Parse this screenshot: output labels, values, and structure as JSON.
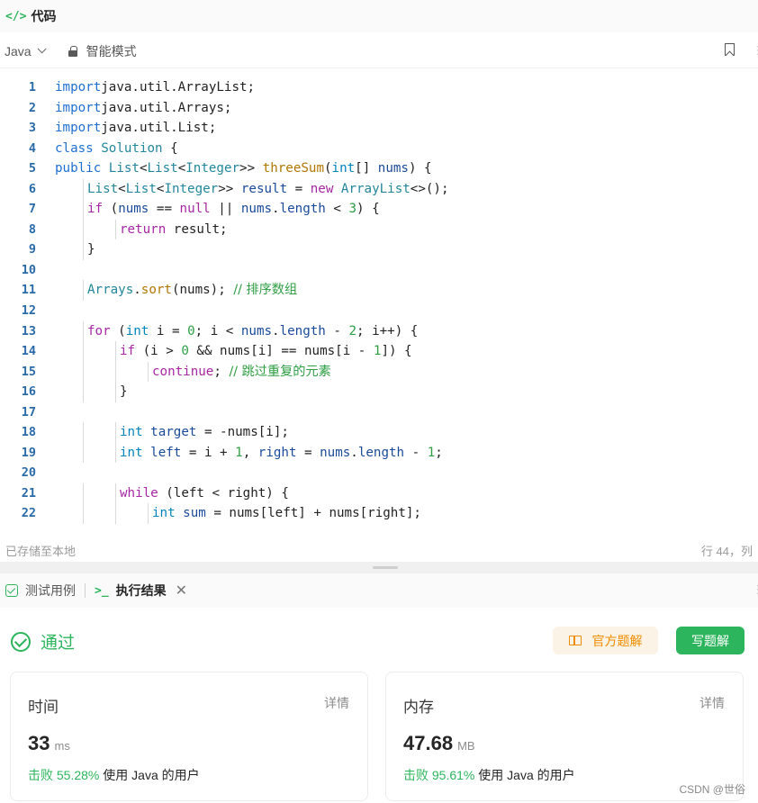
{
  "code_panel": {
    "title_icon": "</>",
    "title": "代码",
    "more": "⋮",
    "language": "Java",
    "mode": "智能模式",
    "status_left": "已存储至本地",
    "status_right": "行 44，列"
  },
  "code_lines": [
    {
      "n": "1",
      "indent": 0,
      "tokens": [
        [
          "kb",
          "import"
        ],
        [
          "",
          "java.util.ArrayList;"
        ]
      ]
    },
    {
      "n": "2",
      "indent": 0,
      "tokens": [
        [
          "kb",
          "import"
        ],
        [
          "",
          "java.util.Arrays;"
        ]
      ]
    },
    {
      "n": "3",
      "indent": 0,
      "tokens": [
        [
          "kb",
          "import"
        ],
        [
          "",
          "java.util.List;"
        ]
      ]
    },
    {
      "n": "4",
      "indent": 0,
      "tokens": [
        [
          "kb",
          "class"
        ],
        [
          "",
          " "
        ],
        [
          "tc",
          "Solution"
        ],
        [
          "",
          " {"
        ]
      ]
    },
    {
      "n": "5",
      "indent": 0,
      "tokens": [
        [
          "kb",
          "public"
        ],
        [
          "",
          " "
        ],
        [
          "tc",
          "List"
        ],
        [
          "",
          "<"
        ],
        [
          "tc",
          "List"
        ],
        [
          "",
          "<"
        ],
        [
          "tc",
          "Integer"
        ],
        [
          "",
          ">> "
        ],
        [
          "fn",
          "threeSum"
        ],
        [
          "",
          "("
        ],
        [
          "ty",
          "int"
        ],
        [
          "",
          "[] "
        ],
        [
          "vr",
          "nums"
        ],
        [
          "",
          ") {"
        ]
      ]
    },
    {
      "n": "6",
      "indent": 1,
      "tokens": [
        [
          "tc",
          "List"
        ],
        [
          "",
          "<"
        ],
        [
          "tc",
          "List"
        ],
        [
          "",
          "<"
        ],
        [
          "tc",
          "Integer"
        ],
        [
          "",
          ">> "
        ],
        [
          "vr",
          "result"
        ],
        [
          "",
          " = "
        ],
        [
          "kw",
          "new"
        ],
        [
          "",
          " "
        ],
        [
          "tc",
          "ArrayList"
        ],
        [
          "",
          "<>();"
        ]
      ]
    },
    {
      "n": "7",
      "indent": 1,
      "tokens": [
        [
          "kw",
          "if"
        ],
        [
          "",
          " ("
        ],
        [
          "vr",
          "nums"
        ],
        [
          "",
          " == "
        ],
        [
          "kw",
          "null"
        ],
        [
          "",
          " || "
        ],
        [
          "vr",
          "nums"
        ],
        [
          "",
          "."
        ],
        [
          "vr",
          "length"
        ],
        [
          "",
          " < "
        ],
        [
          "nm",
          "3"
        ],
        [
          "",
          ") {"
        ]
      ]
    },
    {
      "n": "8",
      "indent": 2,
      "tokens": [
        [
          "kw",
          "return"
        ],
        [
          "",
          " result;"
        ]
      ]
    },
    {
      "n": "9",
      "indent": 1,
      "tokens": [
        [
          "",
          "}"
        ]
      ]
    },
    {
      "n": "10",
      "indent": 0,
      "tokens": []
    },
    {
      "n": "11",
      "indent": 1,
      "tokens": [
        [
          "tc",
          "Arrays"
        ],
        [
          "",
          "."
        ],
        [
          "fn",
          "sort"
        ],
        [
          "",
          "(nums); "
        ],
        [
          "cm",
          "// 排序数组"
        ]
      ]
    },
    {
      "n": "12",
      "indent": 0,
      "tokens": []
    },
    {
      "n": "13",
      "indent": 1,
      "tokens": [
        [
          "kw",
          "for"
        ],
        [
          "",
          " ("
        ],
        [
          "ty",
          "int"
        ],
        [
          "",
          " i = "
        ],
        [
          "nm",
          "0"
        ],
        [
          "",
          "; i < "
        ],
        [
          "vr",
          "nums"
        ],
        [
          "",
          "."
        ],
        [
          "vr",
          "length"
        ],
        [
          "",
          " - "
        ],
        [
          "nm",
          "2"
        ],
        [
          "",
          "; i++) {"
        ]
      ]
    },
    {
      "n": "14",
      "indent": 2,
      "tokens": [
        [
          "kw",
          "if"
        ],
        [
          "",
          " (i > "
        ],
        [
          "nm",
          "0"
        ],
        [
          "",
          " && nums[i] == nums[i - "
        ],
        [
          "nm",
          "1"
        ],
        [
          "",
          "]) {"
        ]
      ]
    },
    {
      "n": "15",
      "indent": 3,
      "tokens": [
        [
          "kw",
          "continue"
        ],
        [
          "",
          "; "
        ],
        [
          "cm",
          "// 跳过重复的元素"
        ]
      ]
    },
    {
      "n": "16",
      "indent": 2,
      "tokens": [
        [
          "",
          "}"
        ]
      ]
    },
    {
      "n": "17",
      "indent": 0,
      "tokens": []
    },
    {
      "n": "18",
      "indent": 2,
      "tokens": [
        [
          "ty",
          "int"
        ],
        [
          "",
          " "
        ],
        [
          "vr",
          "target"
        ],
        [
          "",
          " = -nums[i];"
        ]
      ]
    },
    {
      "n": "19",
      "indent": 2,
      "tokens": [
        [
          "ty",
          "int"
        ],
        [
          "",
          " "
        ],
        [
          "vr",
          "left"
        ],
        [
          "",
          " = i + "
        ],
        [
          "nm",
          "1"
        ],
        [
          "",
          ", "
        ],
        [
          "vr",
          "right"
        ],
        [
          "",
          " = "
        ],
        [
          "vr",
          "nums"
        ],
        [
          "",
          "."
        ],
        [
          "vr",
          "length"
        ],
        [
          "",
          " - "
        ],
        [
          "nm",
          "1"
        ],
        [
          "",
          ";"
        ]
      ]
    },
    {
      "n": "20",
      "indent": 0,
      "tokens": []
    },
    {
      "n": "21",
      "indent": 2,
      "tokens": [
        [
          "kw",
          "while"
        ],
        [
          "",
          " (left < right) {"
        ]
      ]
    },
    {
      "n": "22",
      "indent": 3,
      "tokens": [
        [
          "ty",
          "int"
        ],
        [
          "",
          " "
        ],
        [
          "vr",
          "sum"
        ],
        [
          "",
          " = nums[left] + nums[right];"
        ]
      ]
    }
  ],
  "result_panel": {
    "tab_testcase": "测试用例",
    "tab_result_icon": ">_",
    "tab_result": "执行结果",
    "tab_close": "✕",
    "more": "⋮",
    "verdict": "通过",
    "btn_official": "官方题解",
    "btn_write": "写题解",
    "time": {
      "title": "时间",
      "detail": "详情",
      "value": "33",
      "unit": "ms",
      "beat_prefix": "击败",
      "beat_pct": "55.28%",
      "beat_suffix": "使用 Java 的用户"
    },
    "memory": {
      "title": "内存",
      "detail": "详情",
      "value": "47.68",
      "unit": "MB",
      "beat_prefix": "击败",
      "beat_pct": "95.61%",
      "beat_suffix": "使用 Java 的用户"
    }
  },
  "watermark": "CSDN @世俗"
}
